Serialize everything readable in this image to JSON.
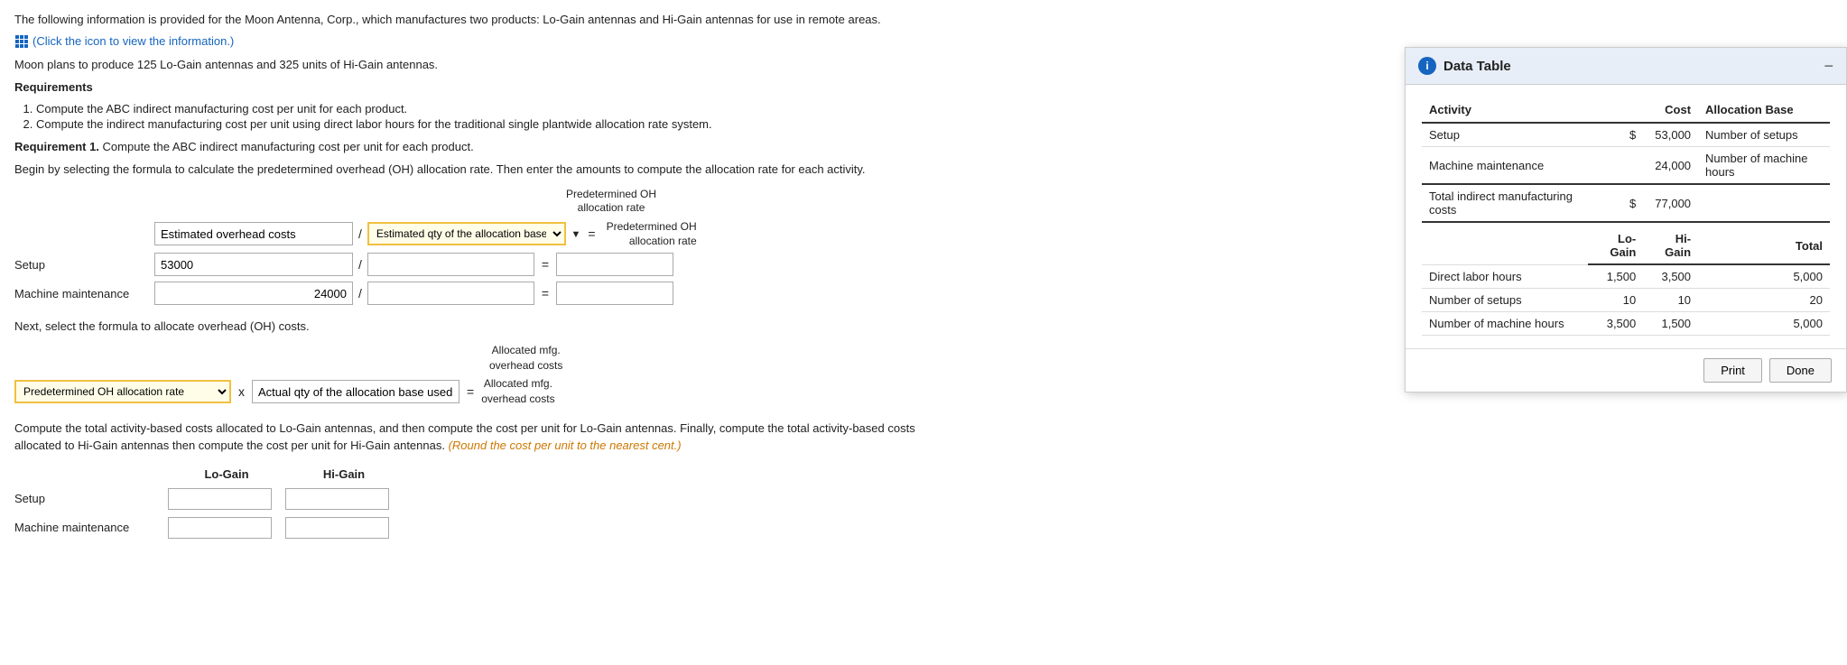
{
  "intro": {
    "line1": "The following information is provided for the Moon Antenna, Corp., which manufactures two products: Lo-Gain antennas and Hi-Gain antennas for use in remote areas.",
    "icon_link": "(Click the icon to view the information.)",
    "line2": "Moon plans to produce 125 Lo-Gain antennas and 325 units of Hi-Gain antennas.",
    "requirements_heading": "Requirements",
    "req1": "Compute the ABC indirect manufacturing cost per unit for each product.",
    "req2": "Compute the indirect manufacturing cost per unit using direct labor hours for the traditional single plantwide allocation rate system.",
    "req1_heading": "Requirement 1.",
    "req1_text": "Compute the ABC indirect manufacturing cost per unit for each product.",
    "begin_text": "Begin by selecting the formula to calculate the predetermined overhead (OH) allocation rate. Then enter the amounts to compute the allocation rate for each activity."
  },
  "formula": {
    "predetermined_oh_label_line1": "Predetermined OH",
    "predetermined_oh_label_line2": "allocation rate",
    "numerator_label": "Estimated overhead costs",
    "denominator_label": "Estimated qty of the allocation base",
    "denominator_dropdown_text": "Estimated qty of the allocation base",
    "setup_label": "Setup",
    "setup_numerator": "53000",
    "machine_label": "Machine maintenance",
    "machine_numerator": "24000"
  },
  "allocate": {
    "intro": "Next, select the formula to allocate overhead (OH) costs.",
    "allocated_label_line1": "Allocated mfg.",
    "allocated_label_line2": "overhead costs",
    "col1_label": "Predetermined OH allocation rate",
    "col2_label": "Actual qty of the allocation base used"
  },
  "bottom": {
    "intro": "Compute the total activity-based costs allocated to Lo-Gain antennas, and then compute the cost per unit for Lo-Gain antennas. Finally, compute the total activity-based costs allocated to Hi-Gain antennas then compute the cost per unit for Hi-Gain",
    "intro2": "antennas.",
    "round_note": "(Round the cost per unit to the nearest cent.)",
    "col_logain": "Lo-Gain",
    "col_higain": "Hi-Gain",
    "row_setup": "Setup",
    "row_machine": "Machine maintenance"
  },
  "popup": {
    "title": "Data Table",
    "table": {
      "col_activity": "Activity",
      "col_cost": "Cost",
      "col_allocation_base": "Allocation Base",
      "rows": [
        {
          "activity": "Setup",
          "cost_symbol": "$",
          "cost_value": "53,000",
          "allocation_base": "Number of setups"
        },
        {
          "activity": "Machine maintenance",
          "cost_symbol": "",
          "cost_value": "24,000",
          "allocation_base": "Number of machine hours"
        },
        {
          "activity": "Total indirect manufacturing costs",
          "cost_symbol": "$",
          "cost_value": "77,000",
          "allocation_base": ""
        }
      ],
      "sub_col_logain": "Lo-Gain",
      "sub_col_higain": "Hi-Gain",
      "sub_col_total": "Total",
      "sub_rows": [
        {
          "label": "Direct labor hours",
          "logain": "1,500",
          "higain": "3,500",
          "total": "5,000"
        },
        {
          "label": "Number of setups",
          "logain": "10",
          "higain": "10",
          "total": "20"
        },
        {
          "label": "Number of machine hours",
          "logain": "3,500",
          "higain": "1,500",
          "total": "5,000"
        }
      ]
    },
    "print_btn": "Print",
    "done_btn": "Done"
  }
}
